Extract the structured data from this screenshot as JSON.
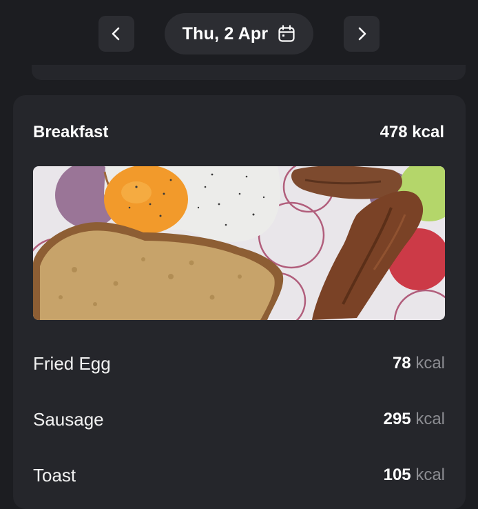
{
  "header": {
    "date_label": "Thu, 2 Apr",
    "prev_icon": "chevron-left-icon",
    "next_icon": "chevron-right-icon",
    "calendar_icon": "calendar-icon"
  },
  "meal": {
    "title": "Breakfast",
    "total_value": "478",
    "total_unit": "kcal",
    "items": [
      {
        "name": "Fried Egg",
        "value": "78",
        "unit": "kcal"
      },
      {
        "name": "Sausage",
        "value": "295",
        "unit": "kcal"
      },
      {
        "name": "Toast",
        "value": "105",
        "unit": "kcal"
      }
    ]
  },
  "colors": {
    "background": "#1c1d21",
    "card": "#25262b",
    "button": "#2c2d32",
    "muted_text": "#8c8d92"
  }
}
